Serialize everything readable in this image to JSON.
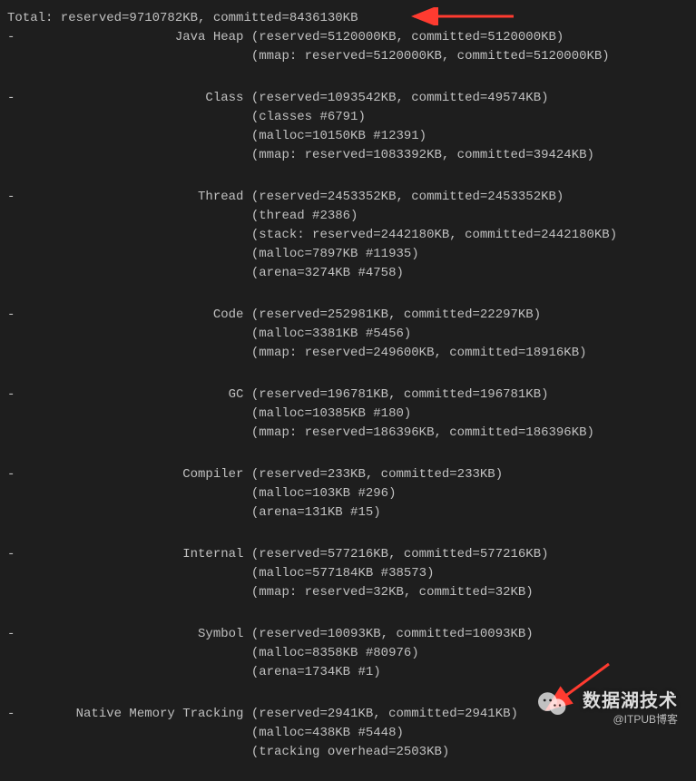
{
  "total": {
    "reserved": "9710782KB",
    "committed": "8436130KB"
  },
  "sections": [
    {
      "name": "Java Heap",
      "header": "(reserved=5120000KB, committed=5120000KB)",
      "details": [
        "(mmap: reserved=5120000KB, committed=5120000KB)"
      ]
    },
    {
      "name": "Class",
      "header": "(reserved=1093542KB, committed=49574KB)",
      "details": [
        "(classes #6791)",
        "(malloc=10150KB #12391)",
        "(mmap: reserved=1083392KB, committed=39424KB)"
      ]
    },
    {
      "name": "Thread",
      "header": "(reserved=2453352KB, committed=2453352KB)",
      "details": [
        "(thread #2386)",
        "(stack: reserved=2442180KB, committed=2442180KB)",
        "(malloc=7897KB #11935)",
        "(arena=3274KB #4758)"
      ]
    },
    {
      "name": "Code",
      "header": "(reserved=252981KB, committed=22297KB)",
      "details": [
        "(malloc=3381KB #5456)",
        "(mmap: reserved=249600KB, committed=18916KB)"
      ]
    },
    {
      "name": "GC",
      "header": "(reserved=196781KB, committed=196781KB)",
      "details": [
        "(malloc=10385KB #180)",
        "(mmap: reserved=186396KB, committed=186396KB)"
      ]
    },
    {
      "name": "Compiler",
      "header": "(reserved=233KB, committed=233KB)",
      "details": [
        "(malloc=103KB #296)",
        "(arena=131KB #15)"
      ]
    },
    {
      "name": "Internal",
      "header": "(reserved=577216KB, committed=577216KB)",
      "details": [
        "(malloc=577184KB #38573)",
        "(mmap: reserved=32KB, committed=32KB)"
      ]
    },
    {
      "name": "Symbol",
      "header": "(reserved=10093KB, committed=10093KB)",
      "details": [
        "(malloc=8358KB #80976)",
        "(arena=1734KB #1)"
      ]
    },
    {
      "name": "Native Memory Tracking",
      "header": "(reserved=2941KB, committed=2941KB)",
      "details": [
        "(malloc=438KB #5448)",
        "(tracking overhead=2503KB)"
      ]
    }
  ],
  "watermark": {
    "cn": "数据湖技术",
    "en": "@ITPUB博客"
  }
}
